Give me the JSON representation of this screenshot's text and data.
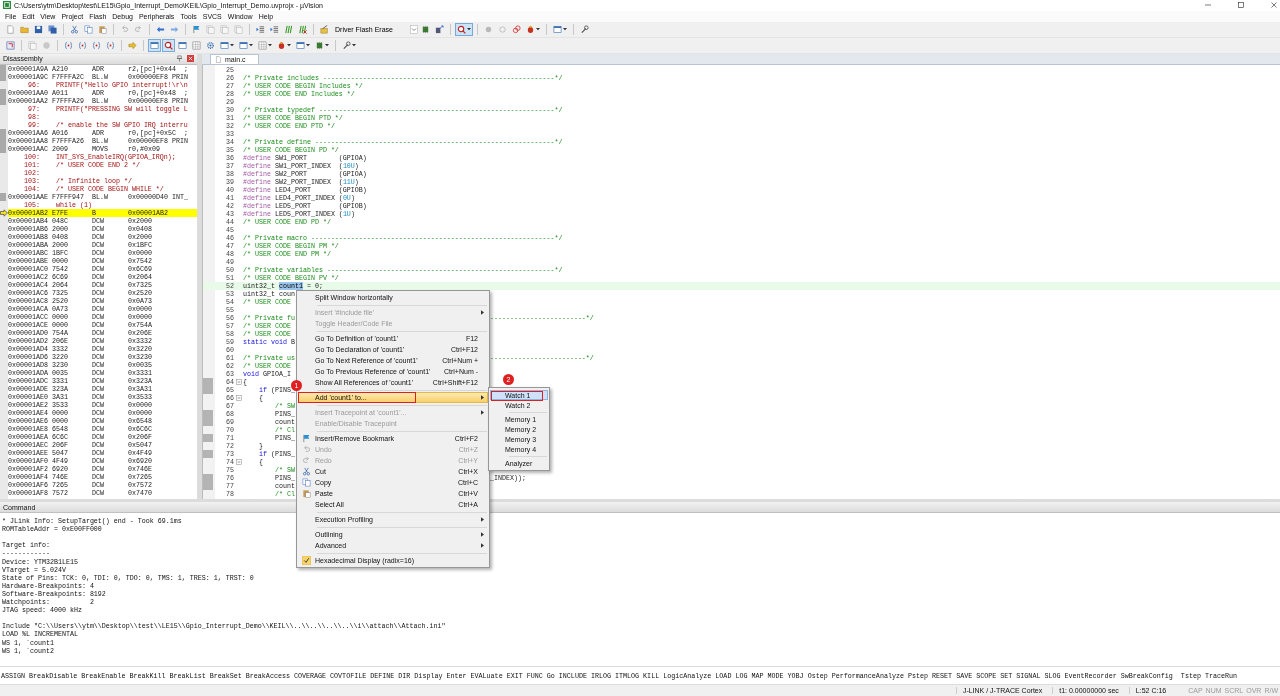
{
  "window": {
    "title": "C:\\Users\\ytm\\Desktop\\test\\LE15\\Gpio_Interrupt_Demo\\KEIL\\Gpio_Interrupt_Demo.uvprojx - µVision"
  },
  "menu": [
    "File",
    "Edit",
    "View",
    "Project",
    "Flash",
    "Debug",
    "Peripherals",
    "Tools",
    "SVCS",
    "Window",
    "Help"
  ],
  "toolbar_1": [
    {
      "kind": "doc",
      "pressed": false,
      "menu": false
    },
    {
      "kind": "folder",
      "pressed": false,
      "menu": false
    },
    {
      "kind": "disk",
      "pressed": false,
      "menu": false
    },
    {
      "kind": "disks",
      "pressed": false,
      "menu": false
    },
    {
      "kind": "sep"
    },
    {
      "kind": "cut",
      "pressed": false,
      "menu": false
    },
    {
      "kind": "copy",
      "pressed": false,
      "menu": false
    },
    {
      "kind": "paste",
      "pressed": false,
      "menu": false
    },
    {
      "kind": "sep"
    },
    {
      "kind": "undo",
      "pressed": false,
      "menu": false
    },
    {
      "kind": "redo",
      "pressed": false,
      "menu": false
    },
    {
      "kind": "sep"
    },
    {
      "kind": "left",
      "pressed": false,
      "menu": false
    },
    {
      "kind": "right",
      "pressed": false,
      "menu": false
    },
    {
      "kind": "sep"
    },
    {
      "kind": "flag",
      "pressed": false,
      "menu": false
    },
    {
      "kind": "pages",
      "pressed": false,
      "menu": false
    },
    {
      "kind": "pages",
      "pressed": false,
      "menu": false
    },
    {
      "kind": "pages",
      "pressed": false,
      "menu": false
    },
    {
      "kind": "sep"
    },
    {
      "kind": "indent",
      "pressed": false,
      "menu": false
    },
    {
      "kind": "indent",
      "pressed": false,
      "menu": false
    },
    {
      "kind": "bars",
      "pressed": false,
      "menu": false
    },
    {
      "kind": "barsx",
      "pressed": false,
      "menu": false
    },
    {
      "kind": "sep"
    },
    {
      "kind": "wand",
      "pressed": false,
      "menu": false
    },
    {
      "kind": "combo",
      "label": "Driver Flash Erase"
    },
    {
      "kind": "chip",
      "pressed": false,
      "menu": false
    },
    {
      "kind": "load",
      "pressed": false,
      "menu": false
    },
    {
      "kind": "sep"
    },
    {
      "kind": "debug",
      "pressed": true,
      "menu": true
    },
    {
      "kind": "sep"
    },
    {
      "kind": "dot",
      "pressed": false,
      "menu": false
    },
    {
      "kind": "ring",
      "pressed": false,
      "menu": false
    },
    {
      "kind": "rings",
      "pressed": false,
      "menu": false
    },
    {
      "kind": "bug",
      "pressed": false,
      "menu": true
    },
    {
      "kind": "sep"
    },
    {
      "kind": "window",
      "pressed": false,
      "menu": true
    },
    {
      "kind": "sep"
    },
    {
      "kind": "wrench",
      "pressed": false,
      "menu": false
    }
  ],
  "toolbar_2": [
    {
      "kind": "reset",
      "pressed": false,
      "menu": false
    },
    {
      "kind": "sep"
    },
    {
      "kind": "pages",
      "pressed": false,
      "menu": false
    },
    {
      "kind": "stop",
      "pressed": false,
      "menu": false
    },
    {
      "kind": "sep"
    },
    {
      "kind": "braces",
      "pressed": false,
      "menu": false
    },
    {
      "kind": "braces",
      "pressed": false,
      "menu": false
    },
    {
      "kind": "braces",
      "pressed": false,
      "menu": false
    },
    {
      "kind": "braces",
      "pressed": false,
      "menu": false
    },
    {
      "kind": "sep"
    },
    {
      "kind": "arrow",
      "pressed": false,
      "menu": false
    },
    {
      "kind": "sep"
    },
    {
      "kind": "window",
      "pressed": true,
      "menu": false
    },
    {
      "kind": "debug",
      "pressed": true,
      "menu": false
    },
    {
      "kind": "window",
      "pressed": false,
      "menu": false
    },
    {
      "kind": "grid",
      "pressed": false,
      "menu": false
    },
    {
      "kind": "gear",
      "pressed": false,
      "menu": false
    },
    {
      "kind": "window",
      "pressed": false,
      "menu": true
    },
    {
      "kind": "window",
      "pressed": false,
      "menu": true
    },
    {
      "kind": "grid",
      "pressed": false,
      "menu": true
    },
    {
      "kind": "bug",
      "pressed": false,
      "menu": true
    },
    {
      "kind": "window",
      "pressed": false,
      "menu": true
    },
    {
      "kind": "chip",
      "pressed": false,
      "menu": true
    },
    {
      "kind": "sep"
    },
    {
      "kind": "wrench",
      "pressed": false,
      "menu": true
    }
  ],
  "disassembly": {
    "title": "Disassembly",
    "rows": [
      {
        "kind": "asm",
        "addr": "0x00001A9A",
        "hex": "A210",
        "op": "ADR",
        "arg": "r2,[pc]+0x44  ;",
        "exec": true,
        "current": false
      },
      {
        "kind": "asm",
        "addr": "0x00001A9C",
        "hex": "F7FFFA2C",
        "op": "BL.W",
        "arg": "0x00000EF8 PRIN",
        "exec": true,
        "current": false
      },
      {
        "kind": "src",
        "n": "96:",
        "text": "PRINTF(\"Hello GPIO interrupt!\\r\\n",
        "exec": false,
        "current": false
      },
      {
        "kind": "asm",
        "addr": "0x00001AA0",
        "hex": "A011",
        "op": "ADR",
        "arg": "r0,[pc]+0x48  ;",
        "exec": true,
        "current": false
      },
      {
        "kind": "asm",
        "addr": "0x00001AA2",
        "hex": "F7FFFA29",
        "op": "BL.W",
        "arg": "0x00000EF8 PRIN",
        "exec": true,
        "current": false
      },
      {
        "kind": "src",
        "n": "97:",
        "text": "PRINTF(\"PRESSING SW will toggle L",
        "exec": false,
        "current": false
      },
      {
        "kind": "src",
        "n": "98:",
        "exec": false,
        "current": false
      },
      {
        "kind": "src",
        "n": "99:",
        "text": "/* enable the SW GPIO IRQ interru",
        "exec": false,
        "current": false
      },
      {
        "kind": "asm",
        "addr": "0x00001AA6",
        "hex": "A016",
        "op": "ADR",
        "arg": "r0,[pc]+0x5C  ;",
        "exec": true,
        "current": false
      },
      {
        "kind": "asm",
        "addr": "0x00001AA8",
        "hex": "F7FFFA26",
        "op": "BL.W",
        "arg": "0x00000EF8 PRIN",
        "exec": true,
        "current": false
      },
      {
        "kind": "asm",
        "addr": "0x00001AAC",
        "hex": "2009",
        "op": "MOVS",
        "arg": "r0,#0x09",
        "exec": true,
        "current": false
      },
      {
        "kind": "src",
        "n": "100:",
        "text": "INT_SYS_EnableIRQ(GPIOA_IRQn);",
        "exec": false,
        "current": false
      },
      {
        "kind": "src",
        "n": "101:",
        "text": "/* USER CODE END 2 */",
        "exec": false,
        "current": false
      },
      {
        "kind": "src",
        "n": "102:",
        "exec": false,
        "current": false
      },
      {
        "kind": "src",
        "n": "103:",
        "text": "/* Infinite loop */",
        "exec": false,
        "current": false
      },
      {
        "kind": "src",
        "n": "104:",
        "text": "/* USER CODE BEGIN WHILE */",
        "exec": false,
        "current": false
      },
      {
        "kind": "asm",
        "addr": "0x00001AAE",
        "hex": "F7FFF947",
        "op": "BL.W",
        "arg": "0x00000D40 INT_",
        "exec": true,
        "current": false
      },
      {
        "kind": "src",
        "n": "105:",
        "text": "while (1)",
        "exec": false,
        "current": false
      },
      {
        "kind": "asm",
        "addr": "0x00001AB2",
        "hex": "E7FE",
        "op": "B",
        "arg": "0x00001AB2",
        "exec": false,
        "current": true
      },
      {
        "kind": "asm",
        "addr": "0x00001AB4",
        "hex": "048C",
        "op": "DCW",
        "arg": "0x2000",
        "exec": false,
        "current": false
      },
      {
        "kind": "asm",
        "addr": "0x00001AB6",
        "hex": "2000",
        "op": "DCW",
        "arg": "0x0408",
        "exec": false,
        "current": false
      },
      {
        "kind": "asm",
        "addr": "0x00001AB8",
        "hex": "0408",
        "op": "DCW",
        "arg": "0x2000",
        "exec": false,
        "current": false
      },
      {
        "kind": "asm",
        "addr": "0x00001ABA",
        "hex": "2000",
        "op": "DCW",
        "arg": "0x1BFC",
        "exec": false,
        "current": false
      },
      {
        "kind": "asm",
        "addr": "0x00001ABC",
        "hex": "1BFC",
        "op": "DCW",
        "arg": "0x0000",
        "exec": false,
        "current": false
      },
      {
        "kind": "asm",
        "addr": "0x00001ABE",
        "hex": "0000",
        "op": "DCW",
        "arg": "0x7542",
        "exec": false,
        "current": false
      },
      {
        "kind": "asm",
        "addr": "0x00001AC0",
        "hex": "7542",
        "op": "DCW",
        "arg": "0x6C69",
        "exec": false,
        "current": false
      },
      {
        "kind": "asm",
        "addr": "0x00001AC2",
        "hex": "6C69",
        "op": "DCW",
        "arg": "0x2064",
        "exec": false,
        "current": false
      },
      {
        "kind": "asm",
        "addr": "0x00001AC4",
        "hex": "2064",
        "op": "DCW",
        "arg": "0x7325",
        "exec": false,
        "current": false
      },
      {
        "kind": "asm",
        "addr": "0x00001AC6",
        "hex": "7325",
        "op": "DCW",
        "arg": "0x2520",
        "exec": false,
        "current": false
      },
      {
        "kind": "asm",
        "addr": "0x00001AC8",
        "hex": "2520",
        "op": "DCW",
        "arg": "0x0A73",
        "exec": false,
        "current": false
      },
      {
        "kind": "asm",
        "addr": "0x00001ACA",
        "hex": "0A73",
        "op": "DCW",
        "arg": "0x0000",
        "exec": false,
        "current": false
      },
      {
        "kind": "asm",
        "addr": "0x00001ACC",
        "hex": "0000",
        "op": "DCW",
        "arg": "0x0000",
        "exec": false,
        "current": false
      },
      {
        "kind": "asm",
        "addr": "0x00001ACE",
        "hex": "0000",
        "op": "DCW",
        "arg": "0x754A",
        "exec": false,
        "current": false
      },
      {
        "kind": "asm",
        "addr": "0x00001AD0",
        "hex": "754A",
        "op": "DCW",
        "arg": "0x206E",
        "exec": false,
        "current": false
      },
      {
        "kind": "asm",
        "addr": "0x00001AD2",
        "hex": "206E",
        "op": "DCW",
        "arg": "0x3332",
        "exec": false,
        "current": false
      },
      {
        "kind": "asm",
        "addr": "0x00001AD4",
        "hex": "3332",
        "op": "DCW",
        "arg": "0x3220",
        "exec": false,
        "current": false
      },
      {
        "kind": "asm",
        "addr": "0x00001AD6",
        "hex": "3220",
        "op": "DCW",
        "arg": "0x3230",
        "exec": false,
        "current": false
      },
      {
        "kind": "asm",
        "addr": "0x00001AD8",
        "hex": "3230",
        "op": "DCW",
        "arg": "0x0035",
        "exec": false,
        "current": false
      },
      {
        "kind": "asm",
        "addr": "0x00001ADA",
        "hex": "0035",
        "op": "DCW",
        "arg": "0x3331",
        "exec": false,
        "current": false
      },
      {
        "kind": "asm",
        "addr": "0x00001ADC",
        "hex": "3331",
        "op": "DCW",
        "arg": "0x323A",
        "exec": false,
        "current": false
      },
      {
        "kind": "asm",
        "addr": "0x00001ADE",
        "hex": "323A",
        "op": "DCW",
        "arg": "0x3A31",
        "exec": false,
        "current": false
      },
      {
        "kind": "asm",
        "addr": "0x00001AE0",
        "hex": "3A31",
        "op": "DCW",
        "arg": "0x3533",
        "exec": false,
        "current": false
      },
      {
        "kind": "asm",
        "addr": "0x00001AE2",
        "hex": "3533",
        "op": "DCW",
        "arg": "0x0000",
        "exec": false,
        "current": false
      },
      {
        "kind": "asm",
        "addr": "0x00001AE4",
        "hex": "0000",
        "op": "DCW",
        "arg": "0x0000",
        "exec": false,
        "current": false
      },
      {
        "kind": "asm",
        "addr": "0x00001AE6",
        "hex": "0000",
        "op": "DCW",
        "arg": "0x6548",
        "exec": false,
        "current": false
      },
      {
        "kind": "asm",
        "addr": "0x00001AE8",
        "hex": "6548",
        "op": "DCW",
        "arg": "0x6C6C",
        "exec": false,
        "current": false
      },
      {
        "kind": "asm",
        "addr": "0x00001AEA",
        "hex": "6C6C",
        "op": "DCW",
        "arg": "0x206F",
        "exec": false,
        "current": false
      },
      {
        "kind": "asm",
        "addr": "0x00001AEC",
        "hex": "206F",
        "op": "DCW",
        "arg": "0x5047",
        "exec": false,
        "current": false
      },
      {
        "kind": "asm",
        "addr": "0x00001AEE",
        "hex": "5047",
        "op": "DCW",
        "arg": "0x4F49",
        "exec": false,
        "current": false
      },
      {
        "kind": "asm",
        "addr": "0x00001AF0",
        "hex": "4F49",
        "op": "DCW",
        "arg": "0x6920",
        "exec": false,
        "current": false
      },
      {
        "kind": "asm",
        "addr": "0x00001AF2",
        "hex": "6920",
        "op": "DCW",
        "arg": "0x746E",
        "exec": false,
        "current": false
      },
      {
        "kind": "asm",
        "addr": "0x00001AF4",
        "hex": "746E",
        "op": "DCW",
        "arg": "0x7265",
        "exec": false,
        "current": false
      },
      {
        "kind": "asm",
        "addr": "0x00001AF6",
        "hex": "7265",
        "op": "DCW",
        "arg": "0x7572",
        "exec": false,
        "current": false
      },
      {
        "kind": "asm",
        "addr": "0x00001AF8",
        "hex": "7572",
        "op": "DCW",
        "arg": "0x7470",
        "exec": false,
        "current": false
      }
    ]
  },
  "editor": {
    "tab": "main.c",
    "lines": [
      {
        "n": "25",
        "exec": false,
        "fold": false,
        "current": false
      },
      {
        "n": "26",
        "segs": [
          {
            "kind": "comment",
            "text": "/* Private includes ----------------------------------------------------------*/"
          }
        ],
        "exec": false,
        "fold": false,
        "current": false
      },
      {
        "n": "27",
        "segs": [
          {
            "kind": "comment",
            "text": "/* USER CODE BEGIN Includes */"
          }
        ],
        "exec": false,
        "fold": false,
        "current": false
      },
      {
        "n": "28",
        "segs": [
          {
            "kind": "comment",
            "text": "/* USER CODE END Includes */"
          }
        ],
        "exec": false,
        "fold": false,
        "current": false
      },
      {
        "n": "29",
        "exec": false,
        "fold": false,
        "current": false
      },
      {
        "n": "30",
        "segs": [
          {
            "kind": "comment",
            "text": "/* Private typedef -----------------------------------------------------------*/"
          }
        ],
        "exec": false,
        "fold": false,
        "current": false
      },
      {
        "n": "31",
        "segs": [
          {
            "kind": "comment",
            "text": "/* USER CODE BEGIN PTD */"
          }
        ],
        "exec": false,
        "fold": false,
        "current": false
      },
      {
        "n": "32",
        "segs": [
          {
            "kind": "comment",
            "text": "/* USER CODE END PTD */"
          }
        ],
        "exec": false,
        "fold": false,
        "current": false
      },
      {
        "n": "33",
        "exec": false,
        "fold": false,
        "current": false
      },
      {
        "n": "34",
        "segs": [
          {
            "kind": "comment",
            "text": "/* Private define ------------------------------------------------------------*/"
          }
        ],
        "exec": false,
        "fold": false,
        "current": false
      },
      {
        "n": "35",
        "segs": [
          {
            "kind": "comment",
            "text": "/* USER CODE BEGIN PD */"
          }
        ],
        "exec": false,
        "fold": false,
        "current": false
      },
      {
        "n": "36",
        "segs": [
          {
            "kind": "pre",
            "text": "#define"
          },
          {
            "kind": "plain",
            "text": " SW1_PORT        (GPIOA)"
          }
        ],
        "exec": false,
        "fold": false,
        "current": false
      },
      {
        "n": "37",
        "segs": [
          {
            "kind": "pre",
            "text": "#define"
          },
          {
            "kind": "plain",
            "text": " SW1_PORT_INDEX  ("
          },
          {
            "kind": "num",
            "text": "10U"
          },
          {
            "kind": "plain",
            "text": ")"
          }
        ],
        "exec": false,
        "fold": false,
        "current": false
      },
      {
        "n": "38",
        "segs": [
          {
            "kind": "pre",
            "text": "#define"
          },
          {
            "kind": "plain",
            "text": " SW2_PORT        (GPIOA)"
          }
        ],
        "exec": false,
        "fold": false,
        "current": false
      },
      {
        "n": "39",
        "segs": [
          {
            "kind": "pre",
            "text": "#define"
          },
          {
            "kind": "plain",
            "text": " SW2_PORT_INDEX  ("
          },
          {
            "kind": "num",
            "text": "11U"
          },
          {
            "kind": "plain",
            "text": ")"
          }
        ],
        "exec": false,
        "fold": false,
        "current": false
      },
      {
        "n": "40",
        "segs": [
          {
            "kind": "pre",
            "text": "#define"
          },
          {
            "kind": "plain",
            "text": " LED4_PORT       (GPIOB)"
          }
        ],
        "exec": false,
        "fold": false,
        "current": false
      },
      {
        "n": "41",
        "segs": [
          {
            "kind": "pre",
            "text": "#define"
          },
          {
            "kind": "plain",
            "text": " LED4_PORT_INDEX ("
          },
          {
            "kind": "num",
            "text": "0U"
          },
          {
            "kind": "plain",
            "text": ")"
          }
        ],
        "exec": false,
        "fold": false,
        "current": false
      },
      {
        "n": "42",
        "segs": [
          {
            "kind": "pre",
            "text": "#define"
          },
          {
            "kind": "plain",
            "text": " LED5_PORT       (GPIOB)"
          }
        ],
        "exec": false,
        "fold": false,
        "current": false
      },
      {
        "n": "43",
        "segs": [
          {
            "kind": "pre",
            "text": "#define"
          },
          {
            "kind": "plain",
            "text": " LED5_PORT_INDEX ("
          },
          {
            "kind": "num",
            "text": "1U"
          },
          {
            "kind": "plain",
            "text": ")"
          }
        ],
        "exec": false,
        "fold": false,
        "current": false
      },
      {
        "n": "44",
        "segs": [
          {
            "kind": "comment",
            "text": "/* USER CODE END PD */"
          }
        ],
        "exec": false,
        "fold": false,
        "current": false
      },
      {
        "n": "45",
        "exec": false,
        "fold": false,
        "current": false
      },
      {
        "n": "46",
        "segs": [
          {
            "kind": "comment",
            "text": "/* Private macro -------------------------------------------------------------*/"
          }
        ],
        "exec": false,
        "fold": false,
        "current": false
      },
      {
        "n": "47",
        "segs": [
          {
            "kind": "comment",
            "text": "/* USER CODE BEGIN PM */"
          }
        ],
        "exec": false,
        "fold": false,
        "current": false
      },
      {
        "n": "48",
        "segs": [
          {
            "kind": "comment",
            "text": "/* USER CODE END PM */"
          }
        ],
        "exec": false,
        "fold": false,
        "current": false
      },
      {
        "n": "49",
        "exec": false,
        "fold": false,
        "current": false
      },
      {
        "n": "50",
        "segs": [
          {
            "kind": "comment",
            "text": "/* Private variables ---------------------------------------------------------*/"
          }
        ],
        "exec": false,
        "fold": false,
        "current": false
      },
      {
        "n": "51",
        "segs": [
          {
            "kind": "comment",
            "text": "/* USER CODE BEGIN PV */"
          }
        ],
        "exec": false,
        "fold": false,
        "current": false
      },
      {
        "n": "52",
        "segs": [
          {
            "kind": "plain",
            "text": "uint32_t "
          },
          {
            "kind": "selected",
            "text": "count1"
          },
          {
            "kind": "plain",
            "text": " = 0;"
          }
        ],
        "exec": false,
        "fold": false,
        "current": true
      },
      {
        "n": "53",
        "segs": [
          {
            "kind": "plain",
            "text": "uint32_t coun"
          }
        ],
        "exec": false,
        "fold": false,
        "current": false
      },
      {
        "n": "54",
        "segs": [
          {
            "kind": "comment",
            "text": "/* USER CODE"
          }
        ],
        "exec": false,
        "fold": false,
        "current": false
      },
      {
        "n": "55",
        "exec": false,
        "fold": false,
        "current": false
      },
      {
        "n": "56",
        "segs": [
          {
            "kind": "comment",
            "text": "/* Private fu"
          }
        ],
        "right": "------------------------*/",
        "exec": false,
        "fold": false,
        "current": false
      },
      {
        "n": "57",
        "segs": [
          {
            "kind": "comment",
            "text": "/* USER CODE"
          }
        ],
        "exec": false,
        "fold": false,
        "current": false
      },
      {
        "n": "58",
        "segs": [
          {
            "kind": "comment",
            "text": "/* USER CODE"
          }
        ],
        "exec": false,
        "fold": false,
        "current": false
      },
      {
        "n": "59",
        "segs": [
          {
            "kind": "keyword",
            "text": "static void"
          },
          {
            "kind": "plain",
            "text": " B"
          }
        ],
        "exec": false,
        "fold": false,
        "current": false
      },
      {
        "n": "60",
        "exec": false,
        "fold": false,
        "current": false
      },
      {
        "n": "61",
        "segs": [
          {
            "kind": "comment",
            "text": "/* Private us"
          }
        ],
        "right": "------------------------*/",
        "exec": false,
        "fold": false,
        "current": false
      },
      {
        "n": "62",
        "segs": [
          {
            "kind": "comment",
            "text": "/* USER CODE"
          }
        ],
        "exec": false,
        "fold": false,
        "current": false
      },
      {
        "n": "63",
        "segs": [
          {
            "kind": "keyword",
            "text": "void"
          },
          {
            "kind": "plain",
            "text": " GPIOA_I"
          }
        ],
        "exec": false,
        "fold": false,
        "current": false
      },
      {
        "n": "64",
        "segs": [
          {
            "kind": "plain",
            "text": "{"
          }
        ],
        "exec": true,
        "fold": true,
        "current": false
      },
      {
        "n": "65",
        "segs": [
          {
            "kind": "keyword",
            "text": "    if"
          },
          {
            "kind": "plain",
            "text": " (PINS_"
          }
        ],
        "exec": true,
        "fold": false,
        "current": false
      },
      {
        "n": "66",
        "segs": [
          {
            "kind": "plain",
            "text": "    {"
          }
        ],
        "exec": false,
        "fold": true,
        "current": false
      },
      {
        "n": "67",
        "segs": [
          {
            "kind": "comment",
            "text": "        /* SW"
          }
        ],
        "exec": false,
        "fold": false,
        "current": false
      },
      {
        "n": "68",
        "segs": [
          {
            "kind": "plain",
            "text": "        PINS_"
          }
        ],
        "exec": true,
        "fold": false,
        "current": false
      },
      {
        "n": "69",
        "segs": [
          {
            "kind": "plain",
            "text": "        count"
          }
        ],
        "exec": true,
        "fold": false,
        "current": false
      },
      {
        "n": "70",
        "segs": [
          {
            "kind": "comment",
            "text": "        /* Cl"
          }
        ],
        "exec": false,
        "fold": false,
        "current": false
      },
      {
        "n": "71",
        "segs": [
          {
            "kind": "plain",
            "text": "        PINS_"
          }
        ],
        "exec": true,
        "fold": false,
        "current": false
      },
      {
        "n": "72",
        "segs": [
          {
            "kind": "plain",
            "text": "    }"
          }
        ],
        "exec": false,
        "fold": false,
        "current": false
      },
      {
        "n": "73",
        "segs": [
          {
            "kind": "keyword",
            "text": "    if"
          },
          {
            "kind": "plain",
            "text": " (PINS_"
          }
        ],
        "exec": true,
        "fold": false,
        "current": false
      },
      {
        "n": "74",
        "segs": [
          {
            "kind": "plain",
            "text": "    {"
          }
        ],
        "exec": false,
        "fold": true,
        "current": false
      },
      {
        "n": "75",
        "segs": [
          {
            "kind": "comment",
            "text": "        /* SW"
          }
        ],
        "exec": false,
        "fold": false,
        "current": false
      },
      {
        "n": "76",
        "segs": [
          {
            "kind": "plain",
            "text": "        PINS_"
          }
        ],
        "right": "_INDEX));",
        "exec": true,
        "fold": false,
        "current": false
      },
      {
        "n": "77",
        "segs": [
          {
            "kind": "plain",
            "text": "        count"
          }
        ],
        "exec": true,
        "fold": false,
        "current": false
      },
      {
        "n": "78",
        "segs": [
          {
            "kind": "comment",
            "text": "        /* Cl"
          }
        ],
        "exec": false,
        "fold": false,
        "current": false
      }
    ]
  },
  "context_menu": {
    "items": [
      {
        "kind": "item",
        "label": "Split Window horizontally",
        "disabled": false,
        "selected": false,
        "checked": false,
        "arrow": false
      },
      {
        "kind": "separator"
      },
      {
        "kind": "item",
        "label": "Insert '#include file'",
        "disabled": true,
        "selected": false,
        "checked": false,
        "arrow": true
      },
      {
        "kind": "item",
        "label": "Toggle Header/Code File",
        "disabled": true,
        "selected": false,
        "checked": false,
        "arrow": false
      },
      {
        "kind": "separator"
      },
      {
        "kind": "item",
        "label": "Go To Definition of 'count1'",
        "shortcut": "F12",
        "disabled": false,
        "selected": false,
        "checked": false,
        "arrow": false
      },
      {
        "kind": "item",
        "label": "Go To Declaration of 'count1'",
        "shortcut": "Ctrl+F12",
        "disabled": false,
        "selected": false,
        "checked": false,
        "arrow": false
      },
      {
        "kind": "item",
        "label": "Go To Next Reference of 'count1'",
        "shortcut": "Ctrl+Num +",
        "disabled": false,
        "selected": false,
        "checked": false,
        "arrow": false
      },
      {
        "kind": "item",
        "label": "Go To Previous Reference of 'count1'",
        "shortcut": "Ctrl+Num -",
        "disabled": false,
        "selected": false,
        "checked": false,
        "arrow": false
      },
      {
        "kind": "item",
        "label": "Show All References of 'count1'",
        "shortcut": "Ctrl+Shift+F12",
        "disabled": false,
        "selected": false,
        "checked": false,
        "arrow": false
      },
      {
        "kind": "separator"
      },
      {
        "kind": "item",
        "label": "Add 'count1' to...",
        "callout": "1",
        "disabled": false,
        "selected": true,
        "checked": false,
        "arrow": true,
        "submenu": [
          {
            "kind": "item",
            "label": "Watch 1",
            "callout": "2",
            "selected": true
          },
          {
            "kind": "item",
            "label": "Watch 2",
            "selected": false
          },
          {
            "kind": "separator"
          },
          {
            "kind": "item",
            "label": "Memory 1",
            "selected": false
          },
          {
            "kind": "item",
            "label": "Memory 2",
            "selected": false
          },
          {
            "kind": "item",
            "label": "Memory 3",
            "selected": false
          },
          {
            "kind": "item",
            "label": "Memory 4",
            "selected": false
          },
          {
            "kind": "separator"
          },
          {
            "kind": "item",
            "label": "Analyzer",
            "selected": false
          }
        ]
      },
      {
        "kind": "separator"
      },
      {
        "kind": "item",
        "label": "Insert Tracepoint at 'count1'...",
        "disabled": true,
        "selected": false,
        "checked": false,
        "arrow": true
      },
      {
        "kind": "item",
        "label": "Enable/Disable Tracepoint",
        "disabled": true,
        "selected": false,
        "checked": false,
        "arrow": false
      },
      {
        "kind": "separator"
      },
      {
        "kind": "bookmark",
        "label": "Insert/Remove Bookmark",
        "shortcut": "Ctrl+F2",
        "disabled": false,
        "selected": false,
        "checked": false,
        "arrow": false
      },
      {
        "kind": "undo",
        "label": "Undo",
        "shortcut": "Ctrl+Z",
        "disabled": true,
        "selected": false,
        "checked": false,
        "arrow": false
      },
      {
        "kind": "redo",
        "label": "Redo",
        "shortcut": "Ctrl+Y",
        "disabled": true,
        "selected": false,
        "checked": false,
        "arrow": false
      },
      {
        "kind": "cut",
        "label": "Cut",
        "shortcut": "Ctrl+X",
        "disabled": false,
        "selected": false,
        "checked": false,
        "arrow": false
      },
      {
        "kind": "copy",
        "label": "Copy",
        "shortcut": "Ctrl+C",
        "disabled": false,
        "selected": false,
        "checked": false,
        "arrow": false
      },
      {
        "kind": "paste",
        "label": "Paste",
        "shortcut": "Ctrl+V",
        "disabled": false,
        "selected": false,
        "checked": false,
        "arrow": false
      },
      {
        "kind": "item",
        "label": "Select All",
        "shortcut": "Ctrl+A",
        "disabled": false,
        "selected": false,
        "checked": false,
        "arrow": false
      },
      {
        "kind": "separator"
      },
      {
        "kind": "item",
        "label": "Execution Profiling",
        "disabled": false,
        "selected": false,
        "checked": false,
        "arrow": true
      },
      {
        "kind": "separator"
      },
      {
        "kind": "item",
        "label": "Outlining",
        "disabled": false,
        "selected": false,
        "checked": false,
        "arrow": true
      },
      {
        "kind": "item",
        "label": "Advanced",
        "disabled": false,
        "selected": false,
        "checked": false,
        "arrow": true
      },
      {
        "kind": "separator"
      },
      {
        "kind": "item",
        "label": "Hexadecimal Display (radix=16)",
        "disabled": false,
        "selected": false,
        "checked": true,
        "arrow": false
      }
    ]
  },
  "command": {
    "title": "Command",
    "blocks": [
      [
        "* JLink Info: SetupTarget() end - Took 69.1ms",
        "ROMTableAddr = 0xE00FF000"
      ],
      [
        "Target info:",
        "------------",
        "Device: YTM32B1LE15",
        "VTarget = 5.024V",
        "State of Pins: TCK: 0, TDI: 0, TDO: 0, TMS: 1, TRES: 1, TRST: 0",
        "Hardware-Breakpoints: 4",
        "Software-Breakpoints: 8192",
        "Watchpoints:          2",
        "JTAG speed: 4000 kHz"
      ],
      [
        "Include \"C:\\\\Users\\\\ytm\\\\Desktop\\\\test\\\\LE15\\\\Gpio_Interrupt_Demo\\\\KEIL\\\\..\\\\..\\\\..\\\\..\\\\i\\\\attach\\\\Attach.ini\"",
        "LOAD %L INCREMENTAL",
        "WS 1, `count1",
        "WS 1, `count2"
      ]
    ],
    "keywords": "ASSIGN BreakDisable BreakEnable BreakKill BreakList BreakSet BreakAccess COVERAGE COVTOFILE DEFINE DIR Display Enter EVALuate EXIT FUNC Go INCLUDE IRLOG ITMLOG KILL LogicAnalyze LOAD LOG MAP MODE YOBJ Ostep PerformanceAnalyze Pstep RESET SAVE SCOPE SET SIGNAL SLOG EventRecorder SwBreakConfig  Tstep TraceRun"
  },
  "status_bar": {
    "panes": [
      "J-LINK / J-TRACE Cortex",
      "t1: 0.00000000 sec",
      "L:52 C:16"
    ],
    "indicators": [
      {
        "text": "CAP",
        "on": false
      },
      {
        "text": "NUM",
        "on": false
      },
      {
        "text": "SCRL",
        "on": false
      },
      {
        "text": "OVR",
        "on": false
      },
      {
        "text": "R/W",
        "on": false
      }
    ]
  }
}
